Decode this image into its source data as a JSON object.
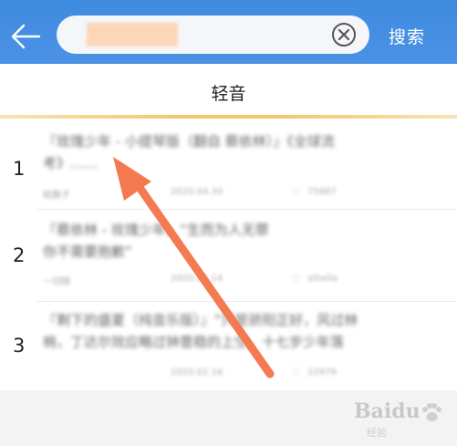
{
  "header": {
    "search_value": "",
    "search_submit_label": "搜索",
    "icons": {
      "back": "back-arrow-icon",
      "clear": "clear-circle-x-icon"
    },
    "colors": {
      "bar": "#4a90e2",
      "search_field": "#f4f6f9",
      "text_on_bar": "#ffffff"
    }
  },
  "tab": {
    "label": "轻音",
    "underline_color": "#f1c86a"
  },
  "results": [
    {
      "index": "1",
      "title_line1": "『玫瑰少年 - 小提琴版（翻自 蔡依林）』《全球流",
      "title_line2": "考》……",
      "author": "桃飘子",
      "date": "2020.04.30",
      "count": "75887"
    },
    {
      "index": "2",
      "title_line1": "『蔡依林 - 玫瑰少年』“生而为人无罪",
      "title_line2": "你不需要抱歉”",
      "author": "一切随",
      "date": "2020.05.14",
      "count": "sthelia"
    },
    {
      "index": "3",
      "title_line1": "『剩下的盛夏（纯音乐版）』“只是骄阳正好，风过林",
      "title_line2": "梢，丁达尔效应略过钟薏稳的上空，十七岁少年落",
      "author": "",
      "date": "2020.02.16",
      "count": "22979"
    }
  ],
  "watermark": {
    "main": "Baidu",
    "sub": "经验"
  },
  "annotation": {
    "arrow_color": "#f47a52"
  }
}
